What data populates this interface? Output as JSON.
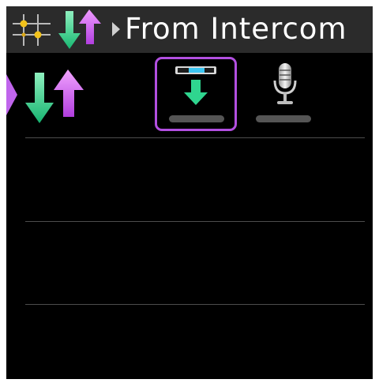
{
  "header": {
    "title": "From Intercom",
    "icons": [
      "grid-icon",
      "transfer-arrows-icon",
      "breadcrumb-arrow-icon"
    ]
  },
  "panel": {
    "icons": [
      "side-tab-arrow-icon",
      "transfer-arrows-icon"
    ],
    "tiles": [
      {
        "name": "download-tile",
        "icon": "download-to-device-icon",
        "selected": true
      },
      {
        "name": "microphone-tile",
        "icon": "microphone-icon",
        "selected": false
      }
    ],
    "list_rows": 3
  },
  "colors": {
    "accent_purple": "#b24fe0",
    "arrow_green": "#2fd58f",
    "arrow_pink": "#d36cf0",
    "grid_yellow": "#f2c21b",
    "header_bg": "#2b2b2b",
    "screen_bg": "#000000"
  }
}
